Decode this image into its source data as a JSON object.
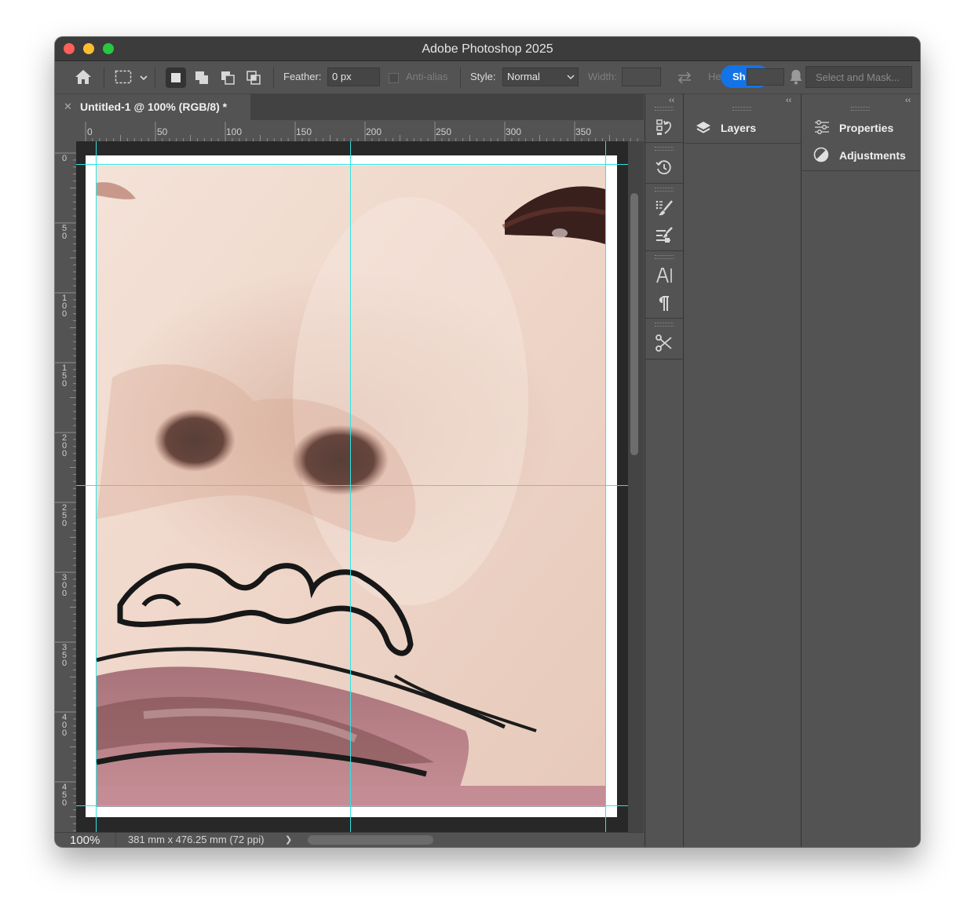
{
  "window": {
    "title": "Adobe Photoshop 2025"
  },
  "options_bar": {
    "feather_label": "Feather:",
    "feather_value": "0 px",
    "anti_alias_label": "Anti-alias",
    "style_label": "Style:",
    "style_value": "Normal",
    "width_label": "Width:",
    "height_label_partial": "He",
    "share_label_partial": "Sh",
    "select_mask_label": "Select and Mask..."
  },
  "document_tab": {
    "title": "Untitled-1 @ 100% (RGB/8) *"
  },
  "rulers": {
    "horizontal": [
      "0",
      "50",
      "100",
      "150",
      "200",
      "250",
      "300",
      "350"
    ],
    "vertical": [
      "0",
      "50",
      "100",
      "150",
      "200",
      "250",
      "300",
      "350",
      "400",
      "450"
    ]
  },
  "status_bar": {
    "zoom": "100%",
    "doc_info": "381 mm x 476.25 mm (72 ppi)",
    "arrow": "❯"
  },
  "panels": {
    "layers_label": "Layers",
    "properties_label": "Properties",
    "adjustments_label": "Adjustments",
    "collapse_glyph": "‹‹"
  },
  "icons": {
    "tool_strip": [
      "history-brush-icon",
      "history-icon",
      "brush-settings-icon",
      "tool-presets-icon",
      "character-icon",
      "paragraph-icon",
      "tools-icon"
    ]
  },
  "colors": {
    "guide": "#2fe3e3",
    "share_button": "#1473e6",
    "ui_bg": "#535353"
  }
}
